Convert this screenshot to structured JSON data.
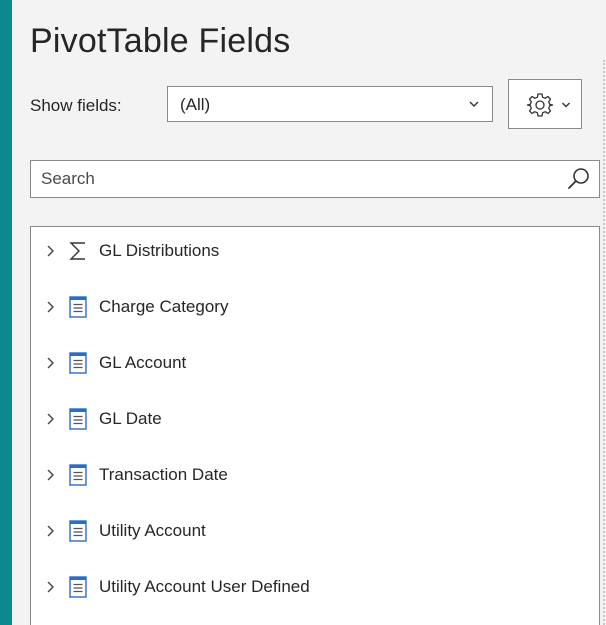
{
  "pane": {
    "title": "PivotTable Fields"
  },
  "show_fields": {
    "label": "Show fields:",
    "selected": "(All)"
  },
  "tools_button": {
    "icon": "gear-icon",
    "dropdown_icon": "chevron-down-icon"
  },
  "search": {
    "placeholder": "Search",
    "icon": "search-icon"
  },
  "fields": [
    {
      "label": "GL Distributions",
      "icon": "sigma-icon"
    },
    {
      "label": "Charge Category",
      "icon": "table-icon"
    },
    {
      "label": "GL Account",
      "icon": "table-icon"
    },
    {
      "label": "GL Date",
      "icon": "table-icon"
    },
    {
      "label": "Transaction Date",
      "icon": "table-icon"
    },
    {
      "label": "Utility Account",
      "icon": "table-icon"
    },
    {
      "label": "Utility Account User Defined",
      "icon": "table-icon"
    }
  ],
  "colors": {
    "window_border": "#0a8a8f",
    "panel_bg": "#f3f3f3",
    "table_icon_blue": "#2b6cc4"
  }
}
